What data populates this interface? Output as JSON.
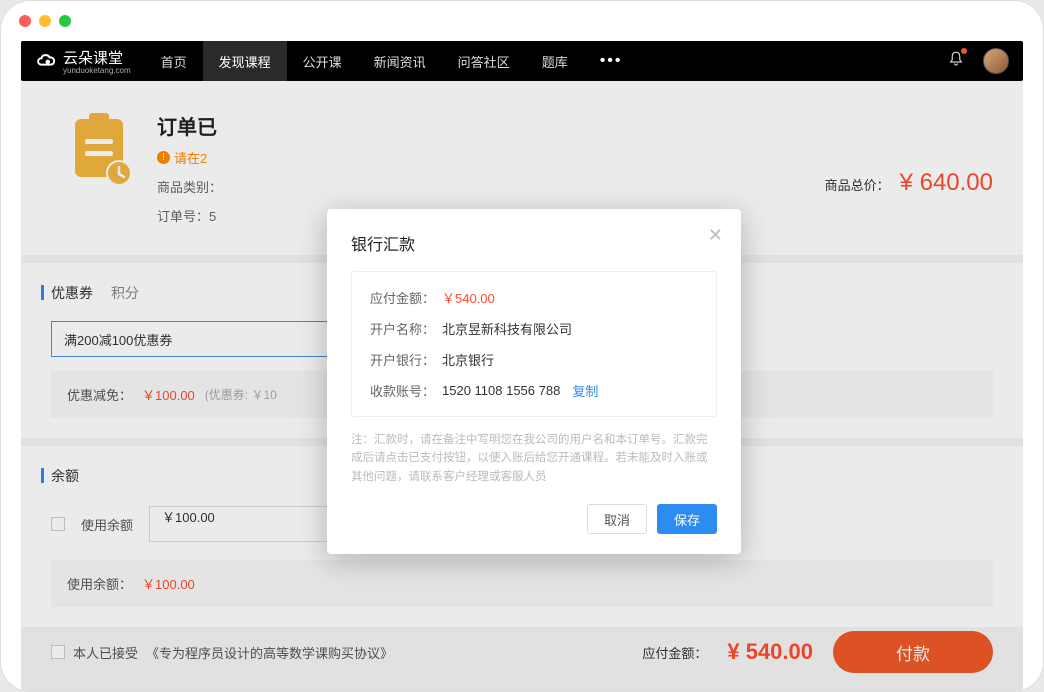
{
  "header": {
    "brand": "云朵课堂",
    "brand_sub": "yunduoketang.com",
    "nav": [
      "首页",
      "发现课程",
      "公开课",
      "新闻资讯",
      "问答社区",
      "题库"
    ],
    "active_nav_index": 1
  },
  "order": {
    "title_prefix": "订单已",
    "warn_prefix": "请在2",
    "meta_category_label": "商品类别：",
    "meta_order_label": "订单号：5",
    "total_label": "商品总价：",
    "total_value": "¥ 640.00"
  },
  "coupon": {
    "tabs": [
      "优惠券",
      "积分"
    ],
    "select_value": "满200减100优惠券",
    "discount_label": "优惠减免：",
    "discount_value": "￥100.00",
    "discount_note": "(优惠券: ￥10"
  },
  "balance": {
    "title": "余额",
    "use_label": "使用余额",
    "input_value": "￥100.00",
    "used_label": "使用余额：",
    "used_value": "￥100.00"
  },
  "footer": {
    "agree_prefix": "本人已接受",
    "agree_link": "《专为程序员设计的高等数学课购买协议》",
    "pay_label": "应付金额：",
    "pay_value": "¥ 540.00",
    "pay_button": "付款"
  },
  "modal": {
    "title": "银行汇款",
    "amount_label": "应付金额：",
    "amount_value": "￥540.00",
    "acct_name_label": "开户名称：",
    "acct_name_value": "北京昱新科技有限公司",
    "bank_label": "开户银行：",
    "bank_value": "北京银行",
    "acct_no_label": "收款账号：",
    "acct_no_value": "1520 1108 1556 788",
    "copy": "复制",
    "note": "注：汇款时，请在备注中写明您在我公司的用户名和本订单号。汇款完成后请点击已支付按钮，以便入账后给您开通课程。若未能及时入账或其他问题，请联系客户经理或客服人员",
    "cancel": "取消",
    "save": "保存"
  }
}
